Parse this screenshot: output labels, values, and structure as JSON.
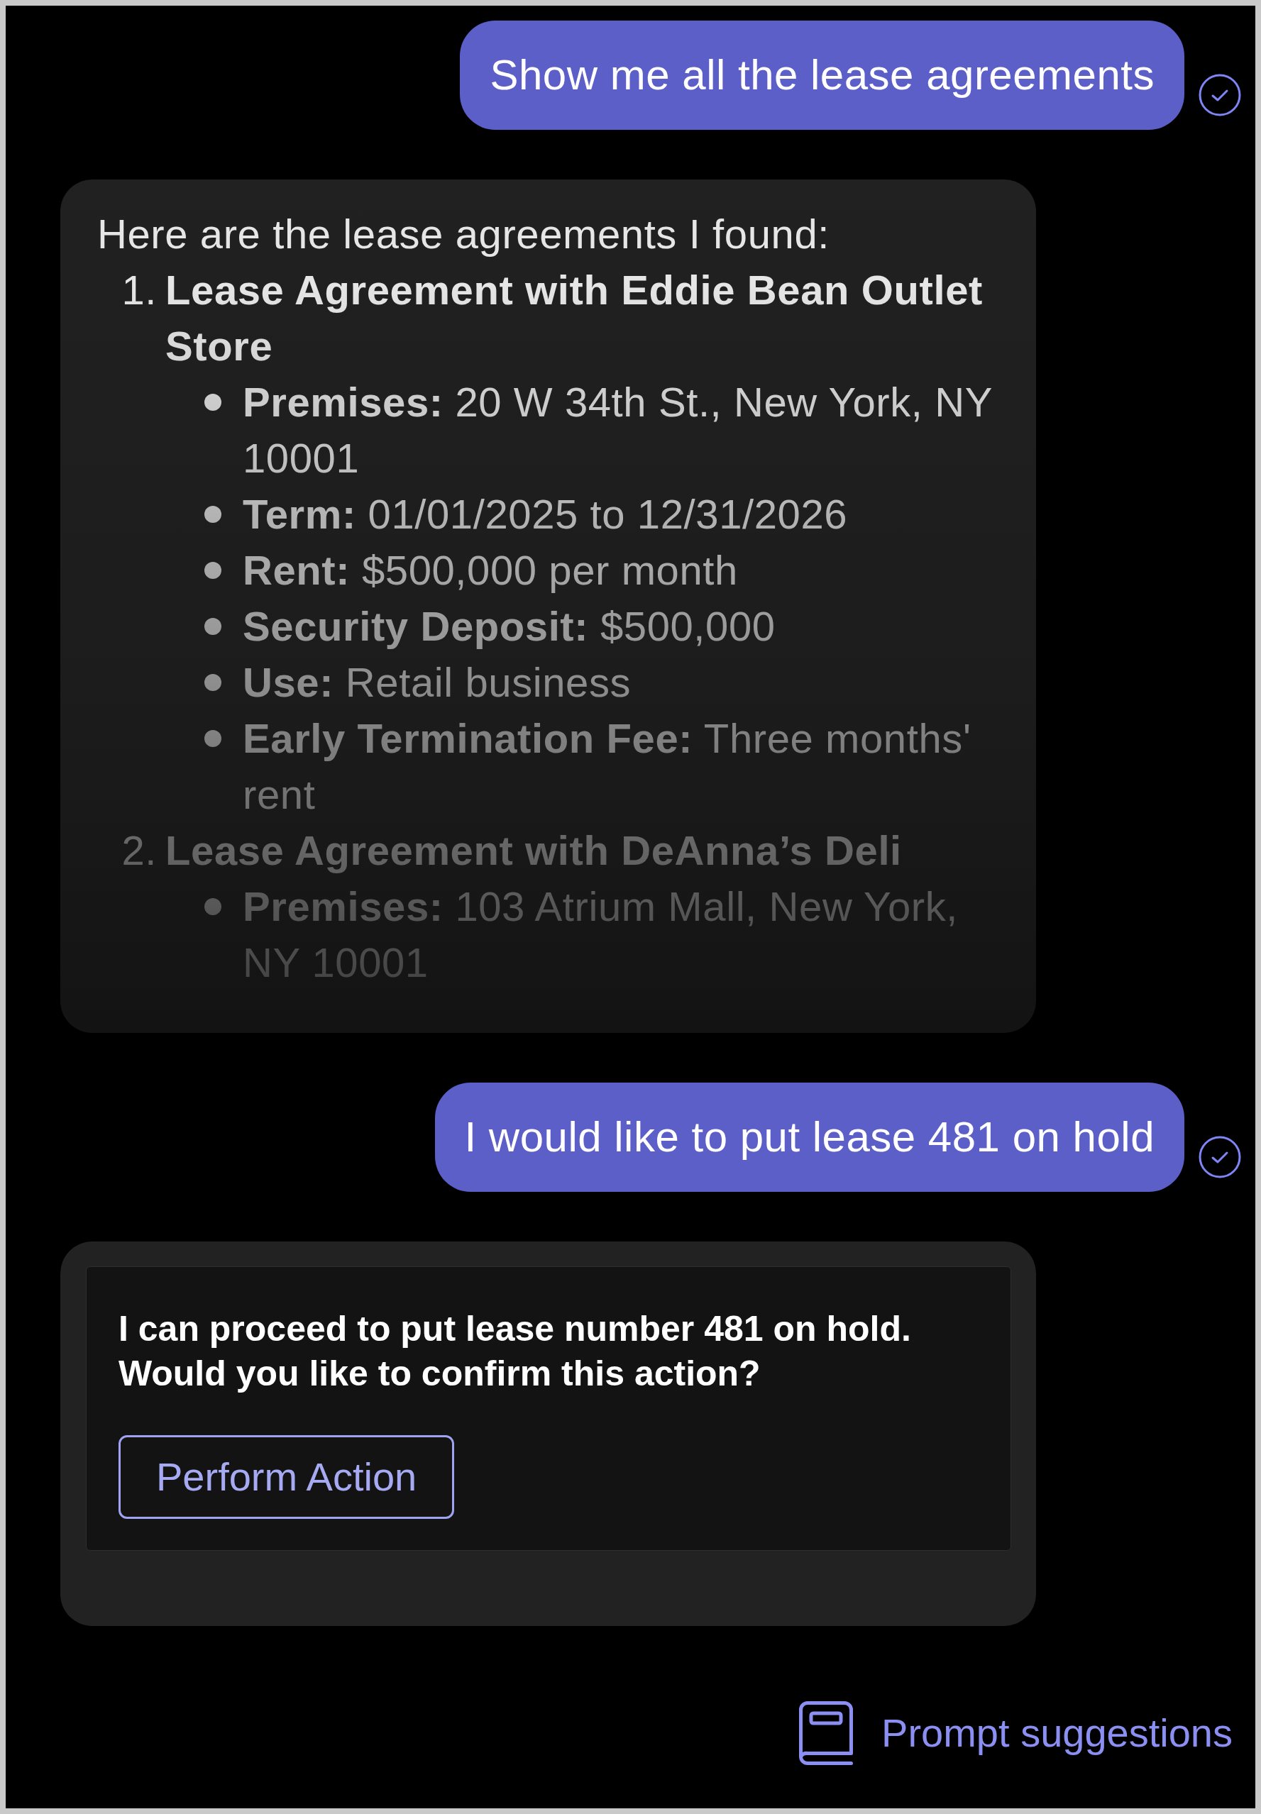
{
  "messages": [
    {
      "kind": "user",
      "text": "Show me all the lease agreements",
      "delivered": true
    },
    {
      "kind": "bot",
      "intro": "Here are the lease agreements I found:",
      "collapsed": true,
      "items": [
        {
          "number": "1.",
          "title": "Lease Agreement with Eddie Bean Outlet Store",
          "details": [
            "**Premises:** 20 W 34th St., New York, NY 10001",
            "**Term:** 01/01/2025 to 12/31/2026",
            "**Rent:** $500,000 per month",
            "**Security Deposit:** $500,000",
            "**Use:** Retail business",
            "**Early Termination Fee:** Three months' rent"
          ]
        },
        {
          "number": "2.",
          "title": "Lease Agreement with DeAnna’s Deli",
          "details": [
            "**Premises:** 103 Atrium Mall, New York, NY 10001"
          ]
        }
      ]
    },
    {
      "kind": "user",
      "text": "I would like to put lease 481 on hold",
      "delivered": true
    },
    {
      "kind": "card",
      "text": "I can proceed to put lease number 481 on hold. Would you like to confirm this action?",
      "button": "Perform Action"
    }
  ],
  "prompt_suggestions": {
    "label": "Prompt suggestions"
  }
}
